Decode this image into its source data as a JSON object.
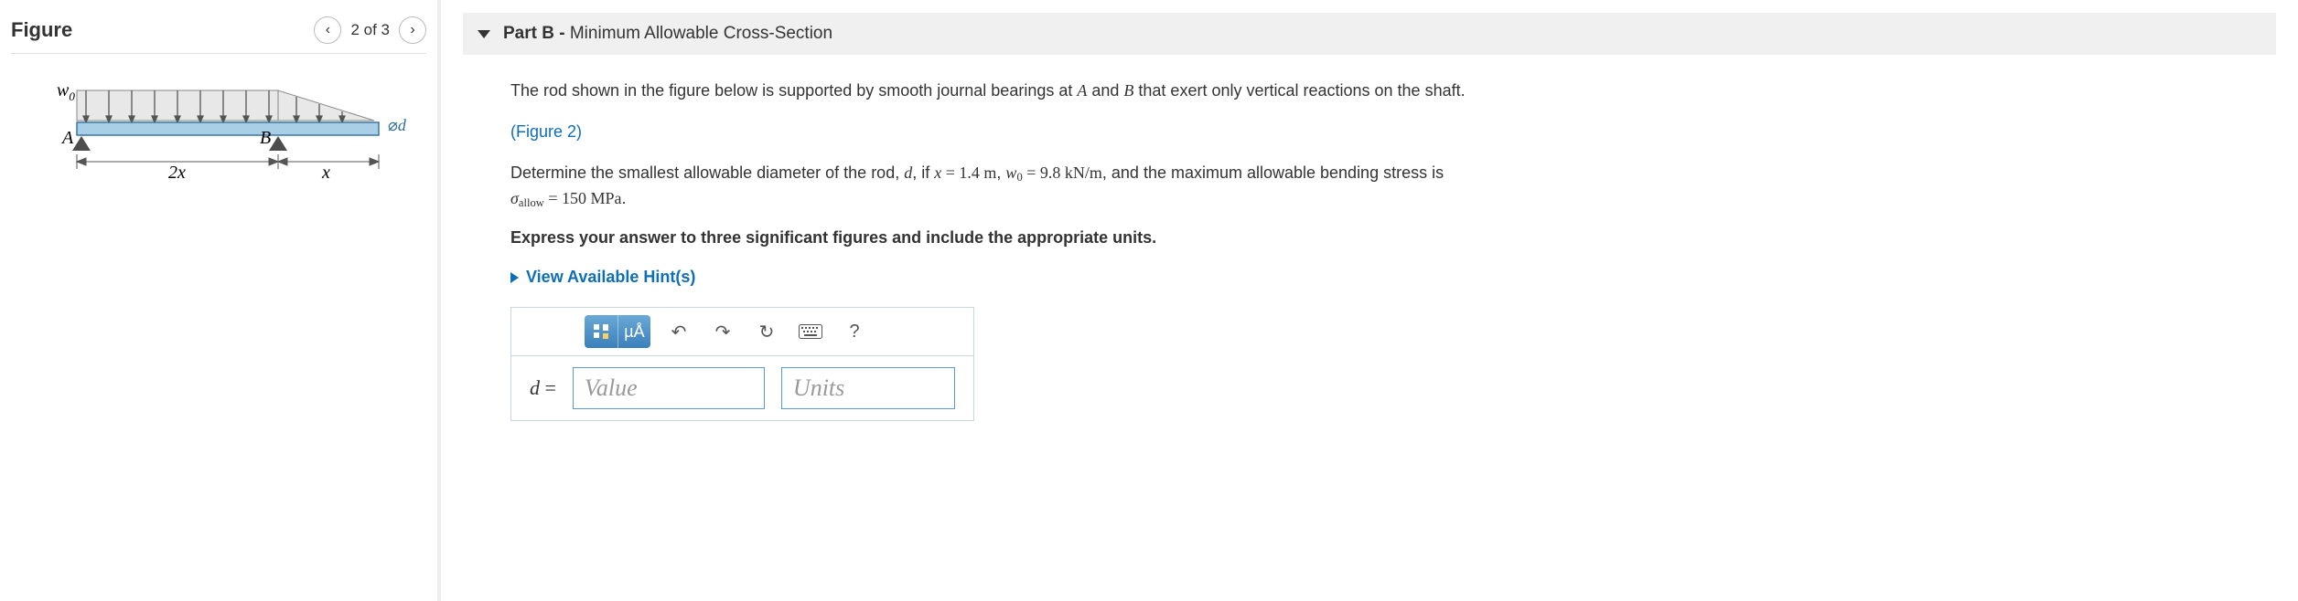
{
  "figure": {
    "title": "Figure",
    "counter": "2 of 3",
    "labels": {
      "w0": "w",
      "w0_sub": "0",
      "A": "A",
      "B": "B",
      "x2": "2x",
      "x": "x",
      "d_sym": "⌀",
      "d": "d"
    }
  },
  "part": {
    "label": "Part B",
    "separator": " - ",
    "title": "Minimum Allowable Cross-Section"
  },
  "text": {
    "line1_pre": "The rod shown in the figure below is supported by smooth journal bearings at ",
    "line1_A": "A",
    "line1_mid": " and ",
    "line1_B": "B",
    "line1_post": " that exert only vertical reactions on the shaft.",
    "fig_link": "(Figure 2)",
    "line2_a": "Determine the smallest allowable diameter of the rod, ",
    "var_d": "d",
    "line2_b": ", if ",
    "var_x": "x",
    "eq": " = ",
    "x_val": "1.4",
    "m_unit": " m",
    "comma": ", ",
    "var_w": "w",
    "w_sub": "0",
    "w_val": "9.8",
    "w_unit": " kN/m",
    "line2_c": ", and the maximum allowable bending stress is ",
    "sigma": "σ",
    "sigma_sub": "allow",
    "sigma_val": "150",
    "sigma_unit": " MPa",
    "period": ".",
    "express": "Express your answer to three significant figures and include the appropriate units."
  },
  "hints": {
    "label": "View Available Hint(s)"
  },
  "answer": {
    "var": "d",
    "equals": " =",
    "value_placeholder": "Value",
    "units_placeholder": "Units",
    "mu_A": "µÅ",
    "help": "?"
  }
}
